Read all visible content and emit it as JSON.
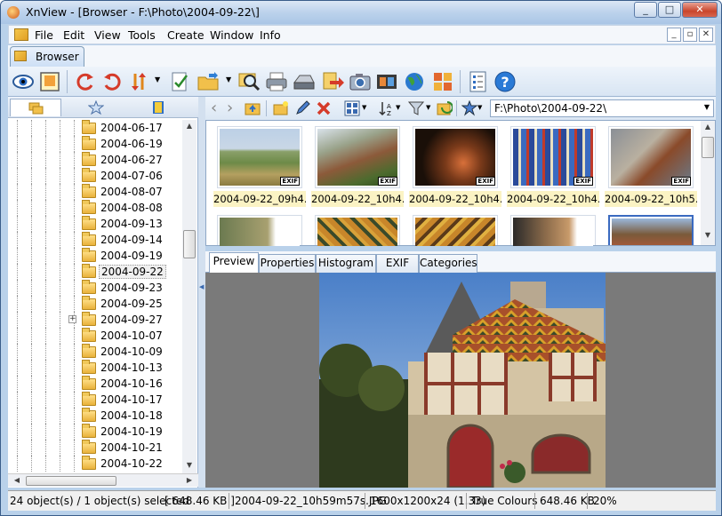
{
  "window": {
    "title": "XnView - [Browser - F:\\Photo\\2004-09-22\\]",
    "controls": [
      "_",
      "□",
      "✕"
    ]
  },
  "menu": [
    "File",
    "Edit",
    "View",
    "Tools",
    "Create",
    "Window",
    "Info"
  ],
  "mdi_controls": [
    "_",
    "▫",
    "✕"
  ],
  "doc_tab": {
    "label": "Browser"
  },
  "tree": {
    "items": [
      "2004-06-17",
      "2004-06-19",
      "2004-06-27",
      "2004-07-06",
      "2004-08-07",
      "2004-08-08",
      "2004-09-13",
      "2004-09-14",
      "2004-09-19",
      "2004-09-22",
      "2004-09-23",
      "2004-09-25",
      "2004-09-27",
      "2004-10-07",
      "2004-10-09",
      "2004-10-13",
      "2004-10-16",
      "2004-10-17",
      "2004-10-18",
      "2004-10-19",
      "2004-10-21",
      "2004-10-22"
    ],
    "selected": "2004-09-22",
    "expandable": "2004-09-27"
  },
  "path": "F:\\Photo\\2004-09-22\\",
  "thumbnails": [
    {
      "label": "2004-09-22_09h4...",
      "badge": "EXIF"
    },
    {
      "label": "2004-09-22_10h4...",
      "badge": "EXIF"
    },
    {
      "label": "2004-09-22_10h4...",
      "badge": "EXIF"
    },
    {
      "label": "2004-09-22_10h4...",
      "badge": "EXIF"
    },
    {
      "label": "2004-09-22_10h5...",
      "badge": "EXIF"
    }
  ],
  "preview_tabs": [
    "Preview",
    "Properties",
    "Histogram",
    "EXIF",
    "Categories"
  ],
  "status": {
    "objects": "24 object(s) / 1 object(s) selected",
    "size": "[ 648.46 KB ]",
    "filename": "2004-09-22_10h59m57s.JPG",
    "dimensions": "1600x1200x24 (1.33)",
    "colors": "True Colours",
    "filesize": "648.46 KB",
    "zoom": "20%"
  }
}
